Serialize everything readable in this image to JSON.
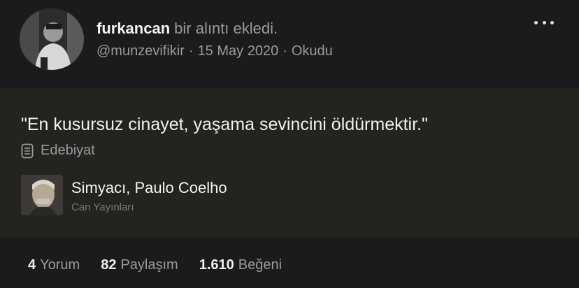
{
  "post": {
    "username": "furkancan",
    "action": "bir alıntı ekledi.",
    "handle": "@munzevifikir",
    "date": "15 May 2020",
    "status": "Okudu",
    "menu_icon": "more-horizontal-icon"
  },
  "quote": {
    "text": "\"En kusursuz cinayet, yaşama sevincini öldürmektir.\"",
    "category_icon": "list-document-icon",
    "category": "Edebiyat",
    "book_title": "Simyacı, Paulo Coelho",
    "publisher": "Can Yayınları"
  },
  "stats": {
    "comments_count": "4",
    "comments_label": "Yorum",
    "shares_count": "82",
    "shares_label": "Paylaşım",
    "likes_count": "1.610",
    "likes_label": "Beğeni"
  },
  "colors": {
    "background": "#1b1b1d",
    "quote_background": "#232320",
    "muted_text": "#9a9a9a"
  }
}
